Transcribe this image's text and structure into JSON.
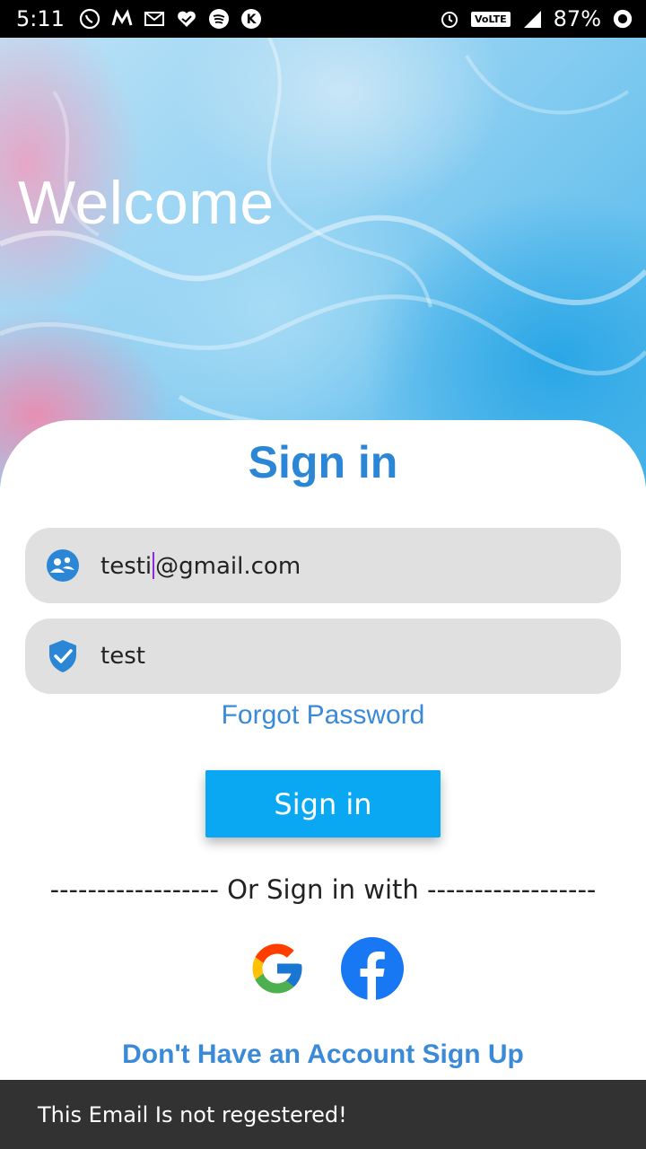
{
  "status_bar": {
    "time": "5:11",
    "network": "VoLTE",
    "battery": "87%",
    "icons": [
      "whatsapp-icon",
      "m-app-icon",
      "gmail-icon",
      "heart-app-icon",
      "spotify-icon",
      "k-app-icon",
      "alarm-icon",
      "signal-icon",
      "battery-icon"
    ]
  },
  "hero": {
    "welcome_text": "Welcome"
  },
  "form": {
    "title": "Sign in",
    "email_value_before_caret": "testi",
    "email_value_after_caret": "@gmail.com",
    "email_icon": "account-icon",
    "password_value": "test",
    "password_icon": "shield-check-icon",
    "forgot_label": "Forgot Password",
    "submit_label": "Sign in",
    "divider_text": "------------------ Or Sign in with ------------------",
    "social": [
      {
        "name": "google-icon"
      },
      {
        "name": "facebook-icon"
      }
    ],
    "signup_label": "Don't Have an Account Sign Up"
  },
  "snackbar": {
    "message": "This Email Is not regestered!"
  },
  "colors": {
    "accent": "#2b87d6",
    "button": "#0aa8f2",
    "field_bg": "#e0e0e0",
    "snackbar_bg": "#323232"
  }
}
